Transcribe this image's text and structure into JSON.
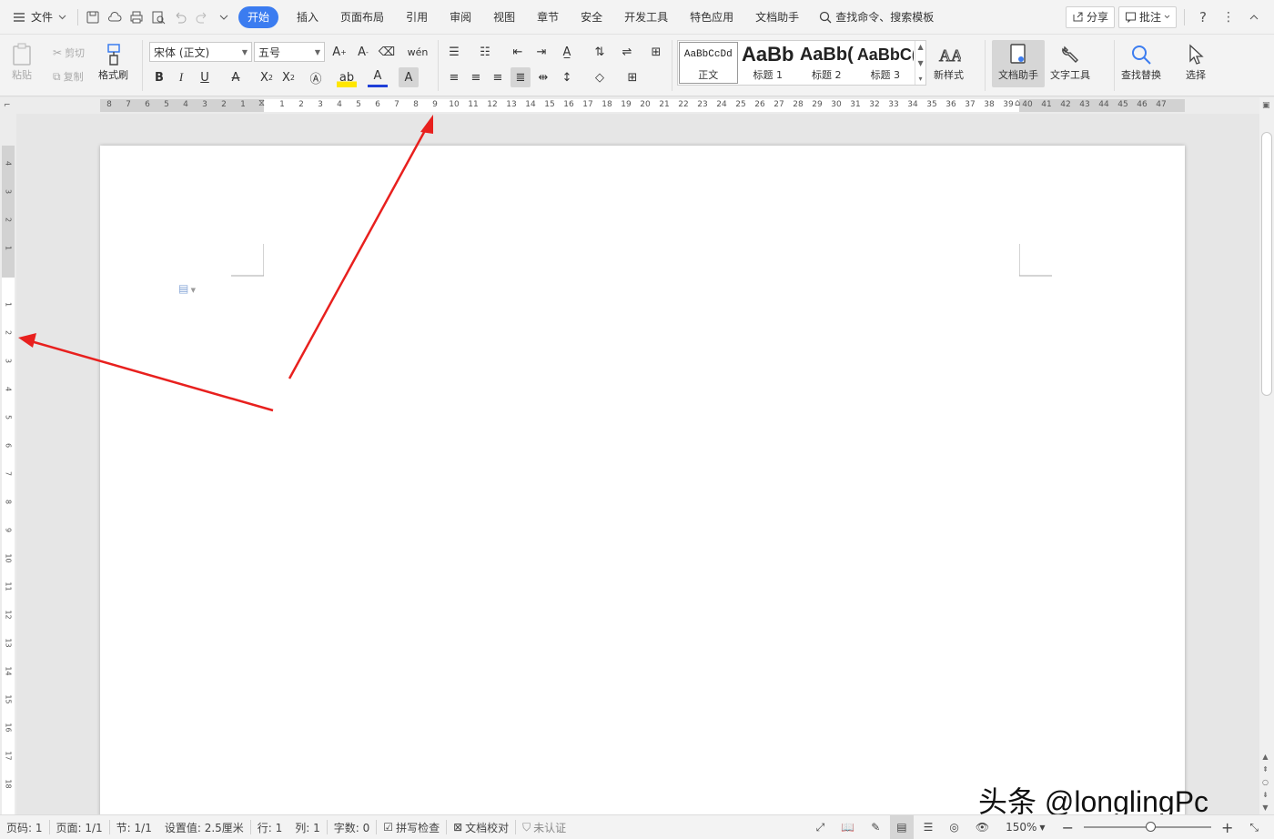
{
  "menubar": {
    "file_label": "文件",
    "tabs": [
      "开始",
      "插入",
      "页面布局",
      "引用",
      "审阅",
      "视图",
      "章节",
      "安全",
      "开发工具",
      "特色应用",
      "文档助手"
    ],
    "search_placeholder": "查找命令、搜索模板",
    "share_label": "分享",
    "comment_label": "批注",
    "help_label": "?"
  },
  "ribbon": {
    "paste_label": "粘贴",
    "cut_label": "剪切",
    "copy_label": "复制",
    "format_painter_label": "格式刷",
    "font_name": "宋体 (正文)",
    "font_size": "五号",
    "styles": [
      {
        "preview": "AaBbCcDd",
        "name": "正文"
      },
      {
        "preview": "AaBb",
        "name": "标题 1"
      },
      {
        "preview": "AaBb(",
        "name": "标题 2"
      },
      {
        "preview": "AaBbC(",
        "name": "标题 3"
      }
    ],
    "new_style_label": "新样式",
    "doc_assistant_label": "文档助手",
    "text_tools_label": "文字工具",
    "find_replace_label": "查找替换",
    "select_label": "选择"
  },
  "hruler": [
    "8",
    "7",
    "6",
    "5",
    "4",
    "3",
    "2",
    "1",
    "1",
    "2",
    "3",
    "4",
    "5",
    "6",
    "7",
    "8",
    "9",
    "10",
    "11",
    "12",
    "13",
    "14",
    "15",
    "16",
    "17",
    "18",
    "19",
    "20",
    "21",
    "22",
    "23",
    "24",
    "25",
    "26",
    "27",
    "28",
    "29",
    "30",
    "31",
    "32",
    "33",
    "34",
    "35",
    "36",
    "37",
    "38",
    "39",
    "40",
    "41",
    "42",
    "43",
    "44",
    "45",
    "46",
    "47"
  ],
  "vruler": [
    "4",
    "3",
    "2",
    "1",
    "1",
    "2",
    "3",
    "4",
    "5",
    "6",
    "7",
    "8",
    "9",
    "10",
    "11",
    "12",
    "13",
    "14",
    "15",
    "16",
    "17",
    "18"
  ],
  "status": {
    "page_num": "页码: 1",
    "pages": "页面: 1/1",
    "section": "节: 1/1",
    "setting": "设置值: 2.5厘米",
    "row": "行: 1",
    "col": "列: 1",
    "word_count": "字数: 0",
    "spell_check": "拼写检查",
    "doc_proof": "文档校对",
    "unverified": "未认证",
    "zoom": "150%"
  },
  "watermark": "头条 @longlingPc",
  "colors": {
    "accent": "#3b7cf0",
    "arrow": "#e8201e"
  }
}
